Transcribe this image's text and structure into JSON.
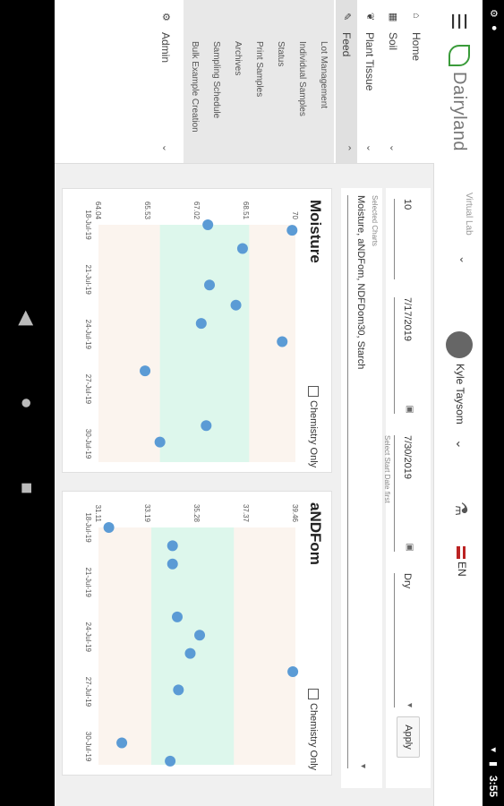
{
  "status_bar": {
    "time": "3:55"
  },
  "app": {
    "brand": "Dairyland",
    "virtual_lab": "Virtual Lab",
    "user_name": "Kyle Taysom",
    "language": "EN"
  },
  "sidebar": {
    "items": [
      {
        "label": "Home",
        "icon": "home-icon"
      },
      {
        "label": "Soil",
        "icon": "soil-icon"
      },
      {
        "label": "Plant Tissue",
        "icon": "plant-icon"
      },
      {
        "label": "Feed",
        "icon": "feed-icon"
      }
    ],
    "feed_sub": [
      "Lot Management",
      "Individual Samples",
      "Status",
      "Print Samples",
      "Archives",
      "Sampling Schedule",
      "Bulk Example Creation"
    ],
    "admin": "Admin"
  },
  "filters": {
    "count_value": "10",
    "start_date": "7/17/2019",
    "end_date": "7/30/2019",
    "date_hint": "Select Start Date first",
    "basis": "Dry",
    "apply": "Apply",
    "selected_charts_label": "Selected Charts",
    "selected_charts_value": "Moisture, aNDFom, NDFDom30, Starch"
  },
  "charts": [
    {
      "title": "Moisture",
      "chemistry_only": "Chemistry Only",
      "chart_data": {
        "type": "scatter",
        "title": "Moisture",
        "x": [
          "18-Jul-19",
          "21-Jul-19",
          "24-Jul-19",
          "27-Jul-19",
          "30-Jul-19"
        ],
        "yticks": [
          "70",
          "68.51",
          "67.02",
          "65.53",
          "64.04"
        ],
        "ylim": [
          64.04,
          70
        ],
        "band": [
          65.9,
          68.6
        ],
        "points": [
          {
            "x": 0.0,
            "y": 67.35
          },
          {
            "x": 0.3,
            "y": 69.9
          },
          {
            "x": 1.3,
            "y": 68.4
          },
          {
            "x": 3.3,
            "y": 67.4
          },
          {
            "x": 4.4,
            "y": 68.2
          },
          {
            "x": 5.4,
            "y": 67.15
          },
          {
            "x": 6.4,
            "y": 69.6
          },
          {
            "x": 8.0,
            "y": 65.45
          },
          {
            "x": 11.0,
            "y": 67.3
          },
          {
            "x": 11.9,
            "y": 65.9
          }
        ]
      }
    },
    {
      "title": "aNDFom",
      "chemistry_only": "Chemistry Only",
      "chart_data": {
        "type": "scatter",
        "title": "aNDFom",
        "x": [
          "18-Jul-19",
          "21-Jul-19",
          "24-Jul-19",
          "27-Jul-19",
          "30-Jul-19"
        ],
        "yticks": [
          "39.46",
          "37.37",
          "35.28",
          "33.19",
          "31.11"
        ],
        "ylim": [
          31.11,
          39.46
        ],
        "band": [
          33.35,
          36.85
        ],
        "points": [
          {
            "x": 0.0,
            "y": 31.55
          },
          {
            "x": 1.0,
            "y": 34.25
          },
          {
            "x": 2.0,
            "y": 34.25
          },
          {
            "x": 4.9,
            "y": 34.45
          },
          {
            "x": 5.9,
            "y": 35.4
          },
          {
            "x": 6.9,
            "y": 35.0
          },
          {
            "x": 7.9,
            "y": 39.35
          },
          {
            "x": 8.9,
            "y": 34.5
          },
          {
            "x": 11.8,
            "y": 32.1
          },
          {
            "x": 12.8,
            "y": 34.15
          }
        ]
      }
    }
  ]
}
